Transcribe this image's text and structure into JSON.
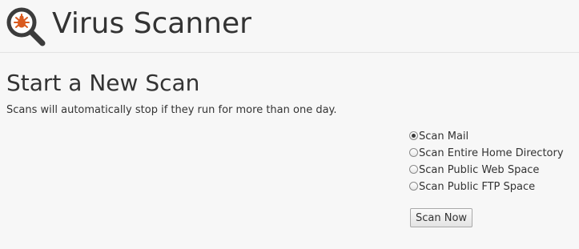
{
  "header": {
    "title": "Virus Scanner",
    "logo_icon": "magnifier-bug-icon",
    "accent_color": "#d95a1e",
    "logo_color": "#3c3c3c"
  },
  "scan": {
    "title": "Start a New Scan",
    "description": "Scans will automatically stop if they run for more than one day.",
    "options": [
      {
        "label": "Scan Mail",
        "checked": true
      },
      {
        "label": "Scan Entire Home Directory",
        "checked": false
      },
      {
        "label": "Scan Public Web Space",
        "checked": false
      },
      {
        "label": "Scan Public FTP Space",
        "checked": false
      }
    ],
    "button_label": "Scan Now"
  }
}
